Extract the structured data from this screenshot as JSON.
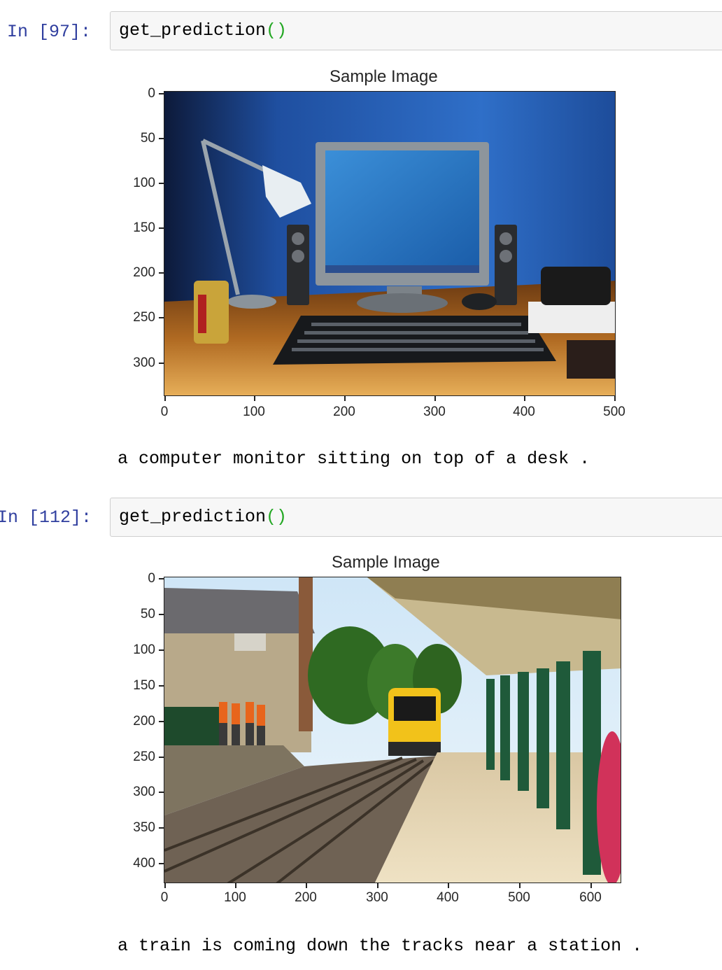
{
  "cells": [
    {
      "prompt": "In [97]:",
      "code_fn": "get_prediction",
      "code_parens": "()",
      "plot_title": "Sample Image",
      "image_desc": "desk-with-monitor",
      "yticks": [
        "0",
        "50",
        "100",
        "150",
        "200",
        "250",
        "300"
      ],
      "xticks": [
        "0",
        "100",
        "200",
        "300",
        "400",
        "500"
      ],
      "caption": "a computer monitor sitting on top of a desk ."
    },
    {
      "prompt": "In [112]:",
      "code_fn": "get_prediction",
      "code_parens": "()",
      "plot_title": "Sample Image",
      "image_desc": "train-station",
      "yticks": [
        "0",
        "50",
        "100",
        "150",
        "200",
        "250",
        "300",
        "350",
        "400"
      ],
      "xticks": [
        "0",
        "100",
        "200",
        "300",
        "400",
        "500",
        "600"
      ],
      "caption": "a train is coming down the tracks near a station ."
    }
  ],
  "colors": {
    "prompt": "#303f9f",
    "paren": "#22a722",
    "input_bg": "#f7f7f7"
  }
}
